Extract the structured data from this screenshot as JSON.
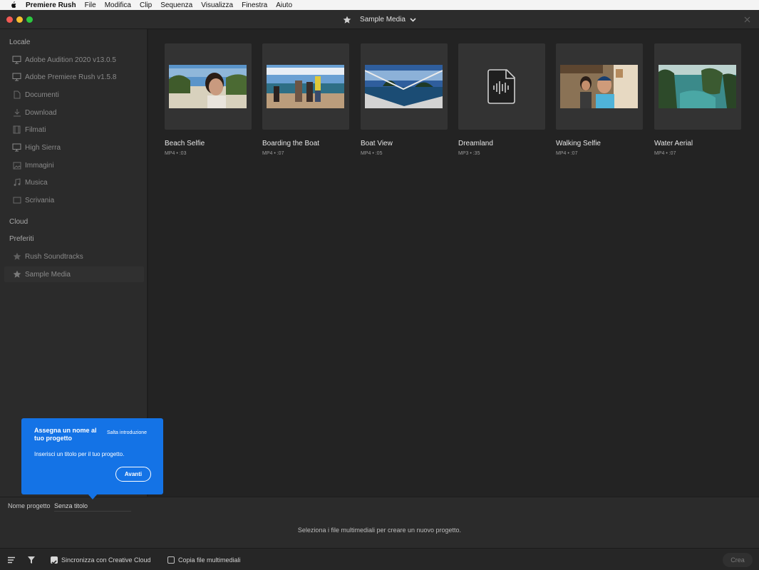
{
  "menubar": {
    "app_name": "Premiere Rush",
    "items": [
      "File",
      "Modifica",
      "Clip",
      "Sequenza",
      "Visualizza",
      "Finestra",
      "Aiuto"
    ]
  },
  "titlebar": {
    "title": "Sample Media"
  },
  "sidebar": {
    "section_local": "Locale",
    "local_items": [
      {
        "label": "Adobe Audition 2020 v13.0.5",
        "icon": "monitor-icon"
      },
      {
        "label": "Adobe Premiere Rush v1.5.8",
        "icon": "monitor-icon"
      },
      {
        "label": "Documenti",
        "icon": "document-icon"
      },
      {
        "label": "Download",
        "icon": "download-icon"
      },
      {
        "label": "Filmati",
        "icon": "film-icon"
      },
      {
        "label": "High Sierra",
        "icon": "monitor-icon"
      },
      {
        "label": "Immagini",
        "icon": "image-icon"
      },
      {
        "label": "Musica",
        "icon": "music-icon"
      },
      {
        "label": "Scrivania",
        "icon": "desktop-icon"
      }
    ],
    "section_cloud": "Cloud",
    "section_favorites": "Preferiti",
    "favorite_items": [
      {
        "label": "Rush Soundtracks",
        "icon": "star-icon"
      },
      {
        "label": "Sample Media",
        "icon": "star-icon"
      }
    ]
  },
  "media": [
    {
      "name": "Beach Selfie",
      "meta": "MP4 • :03"
    },
    {
      "name": "Boarding the Boat",
      "meta": "MP4 • :07"
    },
    {
      "name": "Boat View",
      "meta": "MP4 • :05"
    },
    {
      "name": "Dreamland",
      "meta": "MP3 • :35"
    },
    {
      "name": "Walking Selfie",
      "meta": "MP4 • :07"
    },
    {
      "name": "Water Aerial",
      "meta": "MP4 • :07"
    }
  ],
  "tooltip": {
    "title": "Assegna un nome al tuo progetto",
    "skip": "Salta introduzione",
    "body": "Inserisci un titolo per il tuo progetto.",
    "next": "Avanti"
  },
  "project": {
    "label": "Nome progetto",
    "value": "Senza titolo",
    "hint": "Seleziona i file multimediali per creare un nuovo progetto."
  },
  "bottombar": {
    "sync_label": "Sincronizza con Creative Cloud",
    "sync_checked": true,
    "copy_label": "Copia file multimediali",
    "copy_checked": false,
    "create_label": "Crea"
  },
  "colors": {
    "accent": "#1473e6",
    "background": "#232323",
    "panel": "#2b2b2b"
  }
}
